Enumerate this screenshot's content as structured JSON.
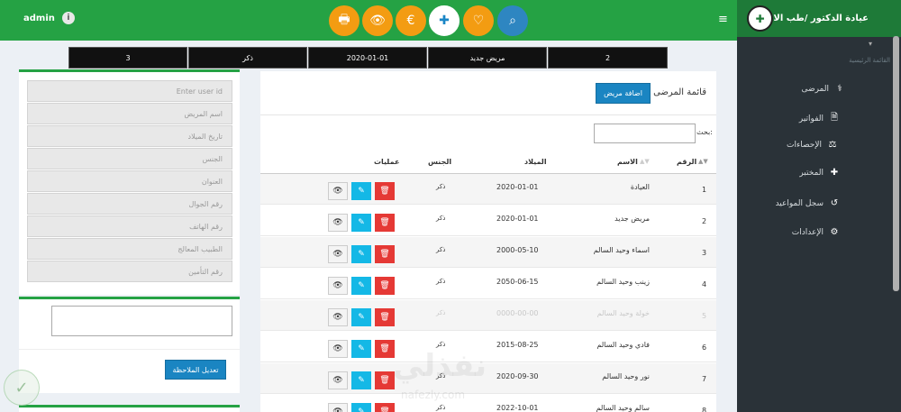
{
  "topbar": {
    "admin_label": "admin",
    "info_icon": "i",
    "buttons": [
      {
        "icon": "print-icon",
        "glyph": "🖶"
      },
      {
        "icon": "eye-icon",
        "glyph": "👁"
      },
      {
        "icon": "euro-icon",
        "glyph": "€"
      },
      {
        "icon": "medkit-icon",
        "glyph": "✚"
      },
      {
        "icon": "heart-icon",
        "glyph": "♡"
      },
      {
        "icon": "search-icon",
        "glyph": "⌕"
      }
    ],
    "menu_glyph": "≡"
  },
  "sidebar": {
    "brand": "عيادة الدكتور /طب الاسنان",
    "section_label": "القائمة الرئيسية",
    "caret": "▾",
    "items": [
      {
        "label": "المرضى",
        "icon": "stethoscope-icon",
        "glyph": "⚕"
      },
      {
        "label": "الفواتير",
        "icon": "invoice-icon",
        "glyph": "🗎"
      },
      {
        "label": "الإحصاءات",
        "icon": "balance-scale-icon",
        "glyph": "⚖"
      },
      {
        "label": "المختبر",
        "icon": "medkit-icon",
        "glyph": "✚"
      },
      {
        "label": "سجل المواعيد",
        "icon": "history-icon",
        "glyph": "↺"
      },
      {
        "label": "الإعدادات",
        "icon": "gear-icon",
        "glyph": "⚙"
      }
    ]
  },
  "info_strip": [
    "3",
    "ذكر",
    "2020-01-01",
    "مريض جديد",
    "2"
  ],
  "form": {
    "fields": [
      "Enter user id",
      "اسم المريض",
      "تاريخ الميلاد",
      "الجنس",
      "العنوان",
      "رقم الجوال",
      "رقم الهاتف",
      "الطبيب المعالج",
      "رقم التأمين"
    ],
    "edit_note_button": "تعديل الملاحظة"
  },
  "list": {
    "title": "قائمة المرضى",
    "add_button": "اضافة مريض",
    "search_label": "بحث:",
    "headers": {
      "num": "الرقم",
      "name": "الاسم",
      "dob": "الميلاد",
      "gender": "الجنس",
      "ops": "عمليات"
    },
    "sort_glyph": "▲▼",
    "rows": [
      {
        "num": "1",
        "name": "العيادة",
        "dob": "2020-01-01",
        "gender": "ذكر"
      },
      {
        "num": "2",
        "name": "مريض جديد",
        "dob": "2020-01-01",
        "gender": "ذكر"
      },
      {
        "num": "3",
        "name": "اسماء وحيد السالم",
        "dob": "2000-05-10",
        "gender": "ذكر"
      },
      {
        "num": "4",
        "name": "زينب وحيد السالم",
        "dob": "2050-06-15",
        "gender": "ذكر"
      },
      {
        "num": "5",
        "name": "خولة وحيد السالم",
        "dob": "0000-00-00",
        "gender": "ذكر"
      },
      {
        "num": "6",
        "name": "فادي وحيد السالم",
        "dob": "2015-08-25",
        "gender": "ذكر"
      },
      {
        "num": "7",
        "name": "نور وحيد السالم",
        "dob": "2020-09-30",
        "gender": "ذكر"
      },
      {
        "num": "8",
        "name": "سالم وحيد السالم",
        "dob": "2022-10-01",
        "gender": "ذكر"
      }
    ],
    "action_glyphs": {
      "view": "👁",
      "edit": "✎",
      "delete": "🗑"
    }
  },
  "watermark": {
    "text": "نفذلي",
    "sub": "nafezly.com"
  },
  "colors": {
    "topbar": "#25a244",
    "sidebar": "#2a3238",
    "primary": "#1a85c2",
    "orange": "#f39c12",
    "danger": "#e53935",
    "info": "#14b8e6"
  }
}
